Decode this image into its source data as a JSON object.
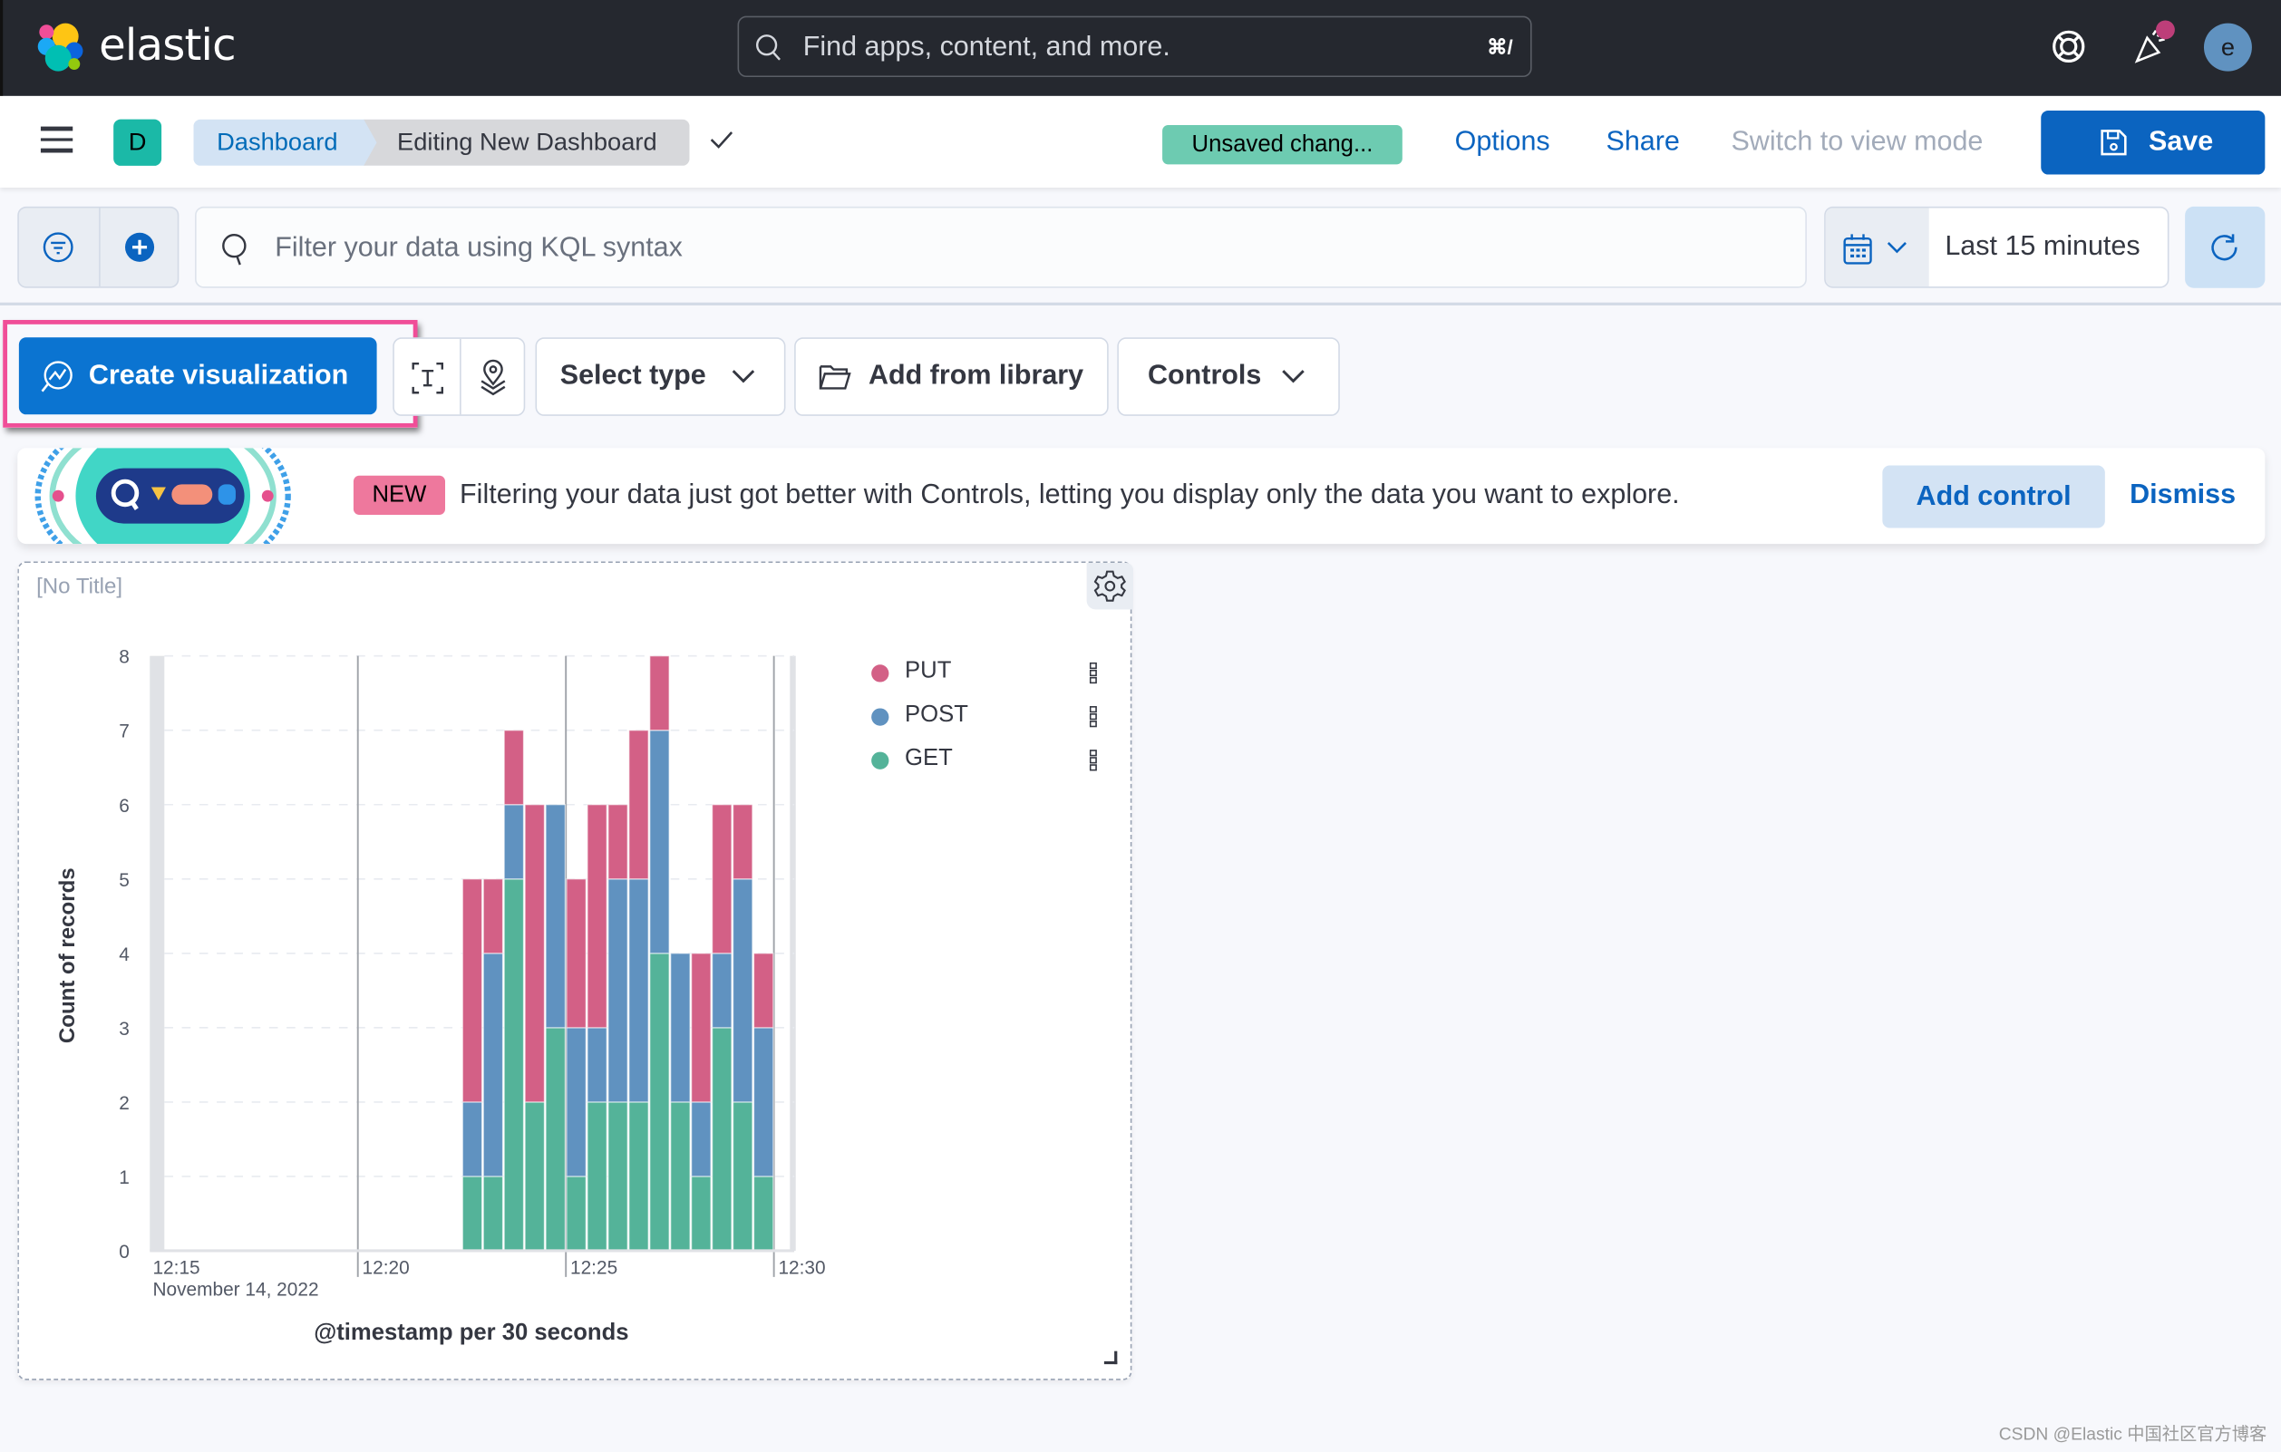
{
  "topbar": {
    "brand": "elastic",
    "search_placeholder": "Find apps, content, and more.",
    "search_shortcut": "⌘/",
    "user_initial": "e",
    "icons": [
      "help-icon",
      "newsfeed-icon",
      "user-avatar"
    ]
  },
  "header": {
    "space_initial": "D",
    "breadcrumbs": [
      "Dashboard",
      "Editing New Dashboard"
    ],
    "unsaved_badge": "Unsaved chang...",
    "options_label": "Options",
    "share_label": "Share",
    "view_mode_label": "Switch to view mode",
    "save_label": "Save"
  },
  "filter_bar": {
    "kql_placeholder": "Filter your data using KQL syntax",
    "time_range": "Last 15 minutes"
  },
  "toolbar": {
    "create_visualization": "Create visualization",
    "select_type": "Select type",
    "add_from_library": "Add from library",
    "controls": "Controls"
  },
  "callout": {
    "badge": "NEW",
    "text": "Filtering your data just got better with Controls, letting you display only the data you want to explore.",
    "add_control": "Add control",
    "dismiss": "Dismiss"
  },
  "panel": {
    "title": "[No Title]"
  },
  "colors": {
    "PUT": "#d36086",
    "POST": "#6092c0",
    "GET": "#54b399",
    "accent": "#0b64c0",
    "highlight": "#f04e98"
  },
  "chart_data": {
    "type": "bar",
    "stacked": true,
    "title": "",
    "xlabel": "@timestamp per 30 seconds",
    "ylabel": "Count of records",
    "ylim": [
      0,
      8
    ],
    "yticks": [
      "0",
      "1",
      "2",
      "3",
      "4",
      "5",
      "6",
      "7",
      "8"
    ],
    "xticks": [
      "12:15",
      "12:20",
      "12:25",
      "12:30"
    ],
    "x_date_label": "November 14, 2022",
    "legend_position": "right",
    "grid": true,
    "categories": [
      "12:22:30",
      "12:23:00",
      "12:23:30",
      "12:24:00",
      "12:24:30",
      "12:25:00",
      "12:25:30",
      "12:26:00",
      "12:26:30",
      "12:27:00",
      "12:27:30",
      "12:28:00",
      "12:28:30",
      "12:29:00",
      "12:29:30"
    ],
    "series": [
      {
        "name": "GET",
        "values": [
          1,
          1,
          5,
          2,
          3,
          1,
          2,
          2,
          2,
          4,
          2,
          1,
          3,
          2,
          1
        ]
      },
      {
        "name": "POST",
        "values": [
          1,
          3,
          1,
          0,
          3,
          2,
          1,
          3,
          3,
          3,
          2,
          1,
          1,
          3,
          2
        ]
      },
      {
        "name": "PUT",
        "values": [
          3,
          1,
          1,
          4,
          0,
          2,
          3,
          1,
          2,
          1,
          0,
          2,
          2,
          1,
          1
        ]
      }
    ],
    "legend": [
      "PUT",
      "POST",
      "GET"
    ]
  },
  "watermark": "CSDN @Elastic 中国社区官方博客"
}
